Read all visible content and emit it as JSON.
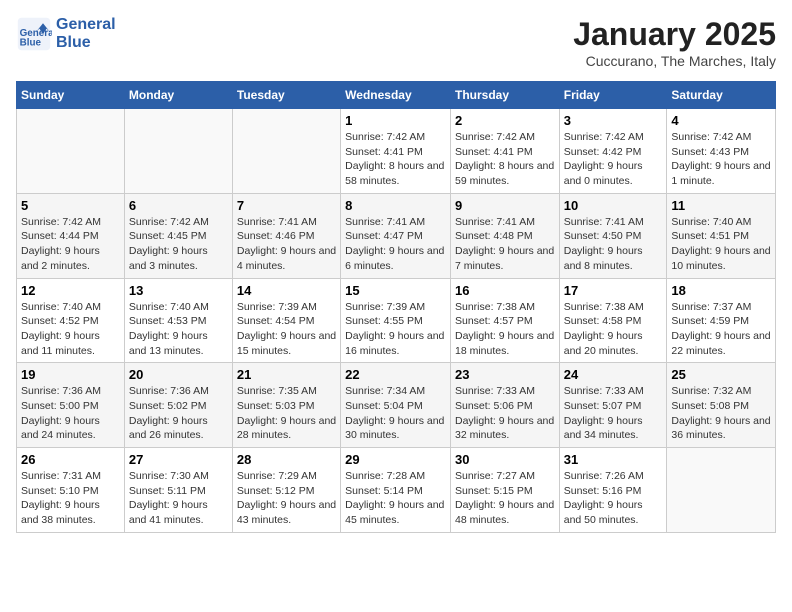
{
  "header": {
    "logo_line1": "General",
    "logo_line2": "Blue",
    "month": "January 2025",
    "location": "Cuccurano, The Marches, Italy"
  },
  "days_of_week": [
    "Sunday",
    "Monday",
    "Tuesday",
    "Wednesday",
    "Thursday",
    "Friday",
    "Saturday"
  ],
  "weeks": [
    [
      {
        "num": "",
        "info": ""
      },
      {
        "num": "",
        "info": ""
      },
      {
        "num": "",
        "info": ""
      },
      {
        "num": "1",
        "info": "Sunrise: 7:42 AM\nSunset: 4:41 PM\nDaylight: 8 hours and 58 minutes."
      },
      {
        "num": "2",
        "info": "Sunrise: 7:42 AM\nSunset: 4:41 PM\nDaylight: 8 hours and 59 minutes."
      },
      {
        "num": "3",
        "info": "Sunrise: 7:42 AM\nSunset: 4:42 PM\nDaylight: 9 hours and 0 minutes."
      },
      {
        "num": "4",
        "info": "Sunrise: 7:42 AM\nSunset: 4:43 PM\nDaylight: 9 hours and 1 minute."
      }
    ],
    [
      {
        "num": "5",
        "info": "Sunrise: 7:42 AM\nSunset: 4:44 PM\nDaylight: 9 hours and 2 minutes."
      },
      {
        "num": "6",
        "info": "Sunrise: 7:42 AM\nSunset: 4:45 PM\nDaylight: 9 hours and 3 minutes."
      },
      {
        "num": "7",
        "info": "Sunrise: 7:41 AM\nSunset: 4:46 PM\nDaylight: 9 hours and 4 minutes."
      },
      {
        "num": "8",
        "info": "Sunrise: 7:41 AM\nSunset: 4:47 PM\nDaylight: 9 hours and 6 minutes."
      },
      {
        "num": "9",
        "info": "Sunrise: 7:41 AM\nSunset: 4:48 PM\nDaylight: 9 hours and 7 minutes."
      },
      {
        "num": "10",
        "info": "Sunrise: 7:41 AM\nSunset: 4:50 PM\nDaylight: 9 hours and 8 minutes."
      },
      {
        "num": "11",
        "info": "Sunrise: 7:40 AM\nSunset: 4:51 PM\nDaylight: 9 hours and 10 minutes."
      }
    ],
    [
      {
        "num": "12",
        "info": "Sunrise: 7:40 AM\nSunset: 4:52 PM\nDaylight: 9 hours and 11 minutes."
      },
      {
        "num": "13",
        "info": "Sunrise: 7:40 AM\nSunset: 4:53 PM\nDaylight: 9 hours and 13 minutes."
      },
      {
        "num": "14",
        "info": "Sunrise: 7:39 AM\nSunset: 4:54 PM\nDaylight: 9 hours and 15 minutes."
      },
      {
        "num": "15",
        "info": "Sunrise: 7:39 AM\nSunset: 4:55 PM\nDaylight: 9 hours and 16 minutes."
      },
      {
        "num": "16",
        "info": "Sunrise: 7:38 AM\nSunset: 4:57 PM\nDaylight: 9 hours and 18 minutes."
      },
      {
        "num": "17",
        "info": "Sunrise: 7:38 AM\nSunset: 4:58 PM\nDaylight: 9 hours and 20 minutes."
      },
      {
        "num": "18",
        "info": "Sunrise: 7:37 AM\nSunset: 4:59 PM\nDaylight: 9 hours and 22 minutes."
      }
    ],
    [
      {
        "num": "19",
        "info": "Sunrise: 7:36 AM\nSunset: 5:00 PM\nDaylight: 9 hours and 24 minutes."
      },
      {
        "num": "20",
        "info": "Sunrise: 7:36 AM\nSunset: 5:02 PM\nDaylight: 9 hours and 26 minutes."
      },
      {
        "num": "21",
        "info": "Sunrise: 7:35 AM\nSunset: 5:03 PM\nDaylight: 9 hours and 28 minutes."
      },
      {
        "num": "22",
        "info": "Sunrise: 7:34 AM\nSunset: 5:04 PM\nDaylight: 9 hours and 30 minutes."
      },
      {
        "num": "23",
        "info": "Sunrise: 7:33 AM\nSunset: 5:06 PM\nDaylight: 9 hours and 32 minutes."
      },
      {
        "num": "24",
        "info": "Sunrise: 7:33 AM\nSunset: 5:07 PM\nDaylight: 9 hours and 34 minutes."
      },
      {
        "num": "25",
        "info": "Sunrise: 7:32 AM\nSunset: 5:08 PM\nDaylight: 9 hours and 36 minutes."
      }
    ],
    [
      {
        "num": "26",
        "info": "Sunrise: 7:31 AM\nSunset: 5:10 PM\nDaylight: 9 hours and 38 minutes."
      },
      {
        "num": "27",
        "info": "Sunrise: 7:30 AM\nSunset: 5:11 PM\nDaylight: 9 hours and 41 minutes."
      },
      {
        "num": "28",
        "info": "Sunrise: 7:29 AM\nSunset: 5:12 PM\nDaylight: 9 hours and 43 minutes."
      },
      {
        "num": "29",
        "info": "Sunrise: 7:28 AM\nSunset: 5:14 PM\nDaylight: 9 hours and 45 minutes."
      },
      {
        "num": "30",
        "info": "Sunrise: 7:27 AM\nSunset: 5:15 PM\nDaylight: 9 hours and 48 minutes."
      },
      {
        "num": "31",
        "info": "Sunrise: 7:26 AM\nSunset: 5:16 PM\nDaylight: 9 hours and 50 minutes."
      },
      {
        "num": "",
        "info": ""
      }
    ]
  ]
}
